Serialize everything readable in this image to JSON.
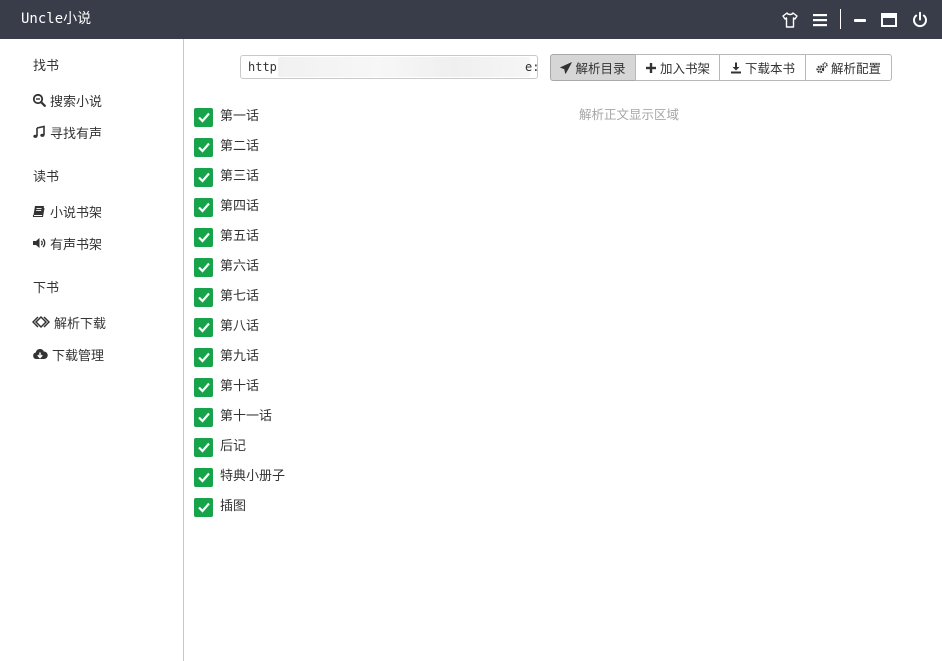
{
  "app": {
    "title": "Uncle小说",
    "accent_color": "#16a34a",
    "titlebar_color": "#393d49"
  },
  "window_controls": [
    {
      "name": "skin-icon"
    },
    {
      "name": "menu-icon"
    },
    {
      "name": "minimize-icon"
    },
    {
      "name": "maximize-icon"
    },
    {
      "name": "power-icon"
    }
  ],
  "sidebar": {
    "sections": [
      {
        "title": "找书",
        "items": [
          {
            "label": "搜索小说",
            "icon": "search-icon"
          },
          {
            "label": "寻找有声",
            "icon": "music-icon"
          }
        ]
      },
      {
        "title": "读书",
        "items": [
          {
            "label": "小说书架",
            "icon": "book-icon"
          },
          {
            "label": "有声书架",
            "icon": "volume-icon"
          }
        ]
      },
      {
        "title": "下书",
        "items": [
          {
            "label": "解析下载",
            "icon": "parse-icon"
          },
          {
            "label": "下载管理",
            "icon": "cloud-download-icon"
          }
        ]
      }
    ]
  },
  "toolbar": {
    "url_value": "http",
    "url_tail": "e:",
    "buttons": [
      {
        "label": "解析目录",
        "icon": "send-icon",
        "active": true
      },
      {
        "label": "加入书架",
        "icon": "plus-icon",
        "active": false
      },
      {
        "label": "下载本书",
        "icon": "download-icon",
        "active": false
      },
      {
        "label": "解析配置",
        "icon": "gears-icon",
        "active": false
      }
    ]
  },
  "content": {
    "hint": "解析正文显示区域"
  },
  "chapters": [
    {
      "label": "第一话",
      "checked": true
    },
    {
      "label": "第二话",
      "checked": true
    },
    {
      "label": "第三话",
      "checked": true
    },
    {
      "label": "第四话",
      "checked": true
    },
    {
      "label": "第五话",
      "checked": true
    },
    {
      "label": "第六话",
      "checked": true
    },
    {
      "label": "第七话",
      "checked": true
    },
    {
      "label": "第八话",
      "checked": true
    },
    {
      "label": "第九话",
      "checked": true
    },
    {
      "label": "第十话",
      "checked": true
    },
    {
      "label": "第十一话",
      "checked": true
    },
    {
      "label": "后记",
      "checked": true
    },
    {
      "label": "特典小册子",
      "checked": true
    },
    {
      "label": "插图",
      "checked": true
    }
  ]
}
